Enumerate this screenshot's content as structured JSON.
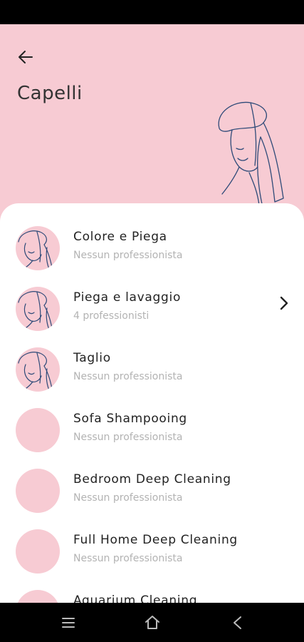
{
  "header": {
    "title": "Capelli",
    "back_icon": "arrow-left-icon",
    "background_color": "#f7cbd3"
  },
  "list": {
    "items": [
      {
        "title": "Colore e Piega",
        "subtitle": "Nessun professionista",
        "has_image": true
      },
      {
        "title": "Piega e lavaggio",
        "subtitle": "4 professionisti",
        "has_image": true,
        "has_chevron": true
      },
      {
        "title": "Taglio",
        "subtitle": "Nessun professionista",
        "has_image": true
      },
      {
        "title": "Sofa Shampooing",
        "subtitle": "Nessun professionista",
        "has_image": false
      },
      {
        "title": "Bedroom Deep Cleaning",
        "subtitle": "Nessun professionista",
        "has_image": false
      },
      {
        "title": "Full Home Deep Cleaning",
        "subtitle": "Nessun professionista",
        "has_image": false
      },
      {
        "title": "Aquarium Cleaning",
        "subtitle": "",
        "has_image": false
      }
    ]
  },
  "nav": {
    "menu_icon": "recent-apps-icon",
    "home_icon": "home-icon",
    "back_icon": "back-triangle-icon"
  }
}
